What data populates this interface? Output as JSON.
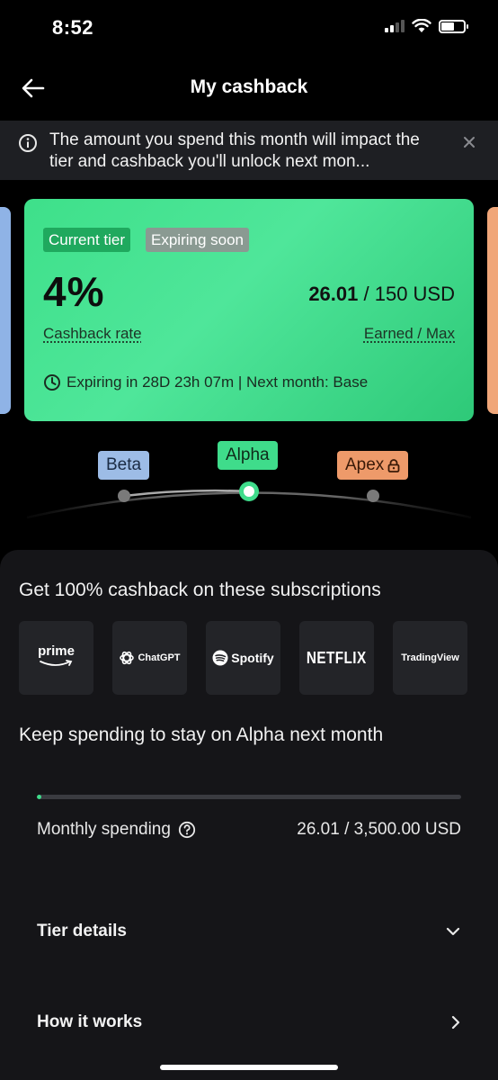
{
  "status_bar": {
    "time": "8:52"
  },
  "header": {
    "title": "My cashback"
  },
  "notice": {
    "text": "The amount you spend this month will impact the tier and cashback you'll unlock next mon..."
  },
  "tier_card": {
    "badge_current": "Current tier",
    "badge_expiring": "Expiring soon",
    "rate": "4%",
    "earned": "26.01",
    "max": "/ 150 USD",
    "rate_label": "Cashback rate",
    "earned_label": "Earned / Max",
    "expiry_text": "Expiring in 28D 23h 07m | Next month: Base"
  },
  "tiers": {
    "beta": "Beta",
    "alpha": "Alpha",
    "apex": "Apex"
  },
  "promo": {
    "title": "Get 100% cashback on these subscriptions",
    "subscriptions": [
      "prime",
      "ChatGPT",
      "Spotify",
      "NETFLIX",
      "TradingView"
    ]
  },
  "spending": {
    "title": "Keep spending to stay on Alpha next month",
    "label": "Monthly spending",
    "value": "26.01 / 3,500.00 USD",
    "progress_fraction": 0.0074
  },
  "sections": {
    "tier_details": "Tier details",
    "how_it_works": "How it works"
  },
  "colors": {
    "accent_green": "#3fdc8b",
    "beta_blue": "#9dbce6",
    "apex_orange": "#ee9a6a",
    "sheet_bg": "#151518"
  },
  "icons": [
    "back-arrow-icon",
    "info-icon",
    "close-icon",
    "clock-icon",
    "lock-icon",
    "help-circle-icon",
    "chevron-down-icon",
    "chevron-right-icon",
    "wifi-icon",
    "signal-icon",
    "battery-icon",
    "openai-icon",
    "spotify-icon"
  ]
}
